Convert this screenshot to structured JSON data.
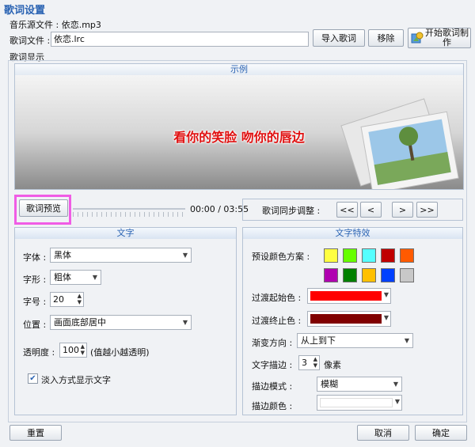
{
  "window": {
    "title": "歌词设置"
  },
  "source": {
    "label": "音乐源文件 : 依恋.mp3"
  },
  "lyrics_file": {
    "label": "歌词文件 :",
    "value": "依恋.lrc"
  },
  "buttons": {
    "import": "导入歌词",
    "remove": "移除",
    "start_make_line1": "开始歌词制",
    "start_make_line2": "作",
    "preview": "歌词预览",
    "reset": "重置",
    "cancel": "取消",
    "ok": "确定"
  },
  "lyrics_display": {
    "group_label": "歌词显示",
    "example_label": "示例",
    "sample_text": "看你的笑脸  吻你的唇边"
  },
  "playback": {
    "time": "00:00 / 03:55",
    "progress": 0
  },
  "sync": {
    "label": "歌词同步调整 :",
    "buttons": [
      "<<",
      "<",
      ">",
      ">>"
    ]
  },
  "text_panel": {
    "header": "文字",
    "font_label": "字体 :",
    "font_value": "黑体",
    "style_label": "字形 :",
    "style_value": "粗体",
    "size_label": "字号 :",
    "size_value": "20",
    "position_label": "位置 :",
    "position_value": "画面底部居中",
    "opacity_label": "透明度 :",
    "opacity_value": "100",
    "opacity_hint": "(值越小越透明)",
    "fade_label": "淡入方式显示文字",
    "fade_checked": true
  },
  "effects_panel": {
    "header": "文字特效",
    "preset_label": "预设颜色方案 :",
    "presets": [
      "#ffff40",
      "#66ff00",
      "#55ffff",
      "#c00000",
      "#ff5a00",
      "#b000b0",
      "#008000",
      "#ffc000",
      "#0040ff",
      "#c8c8c8"
    ],
    "start_color_label": "过渡起始色 :",
    "start_color": "#ff0000",
    "end_color_label": "过渡终止色 :",
    "end_color": "#800000",
    "direction_label": "渐变方向 :",
    "direction_value": "从上到下",
    "outline_label": "文字描边 :",
    "outline_value": "3",
    "outline_unit": "像素",
    "outline_mode_label": "描边模式 :",
    "outline_mode_value": "模糊",
    "outline_color_label": "描边颜色 :",
    "outline_color": "#ffffff"
  },
  "colors": {
    "accent": "#2a63b3",
    "highlight": "#f05ce5"
  }
}
